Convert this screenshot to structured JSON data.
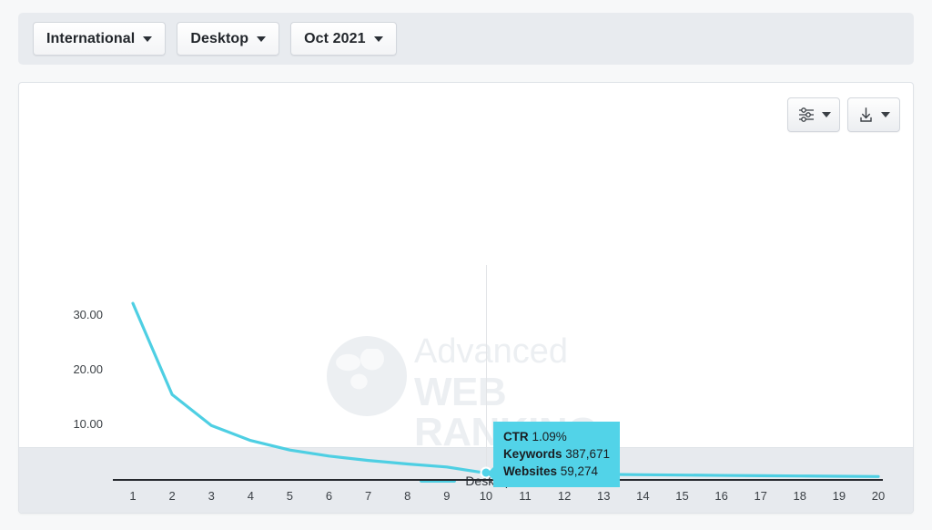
{
  "toolbar": {
    "filters": [
      {
        "label": "International",
        "icon": "chevron-down-icon"
      },
      {
        "label": "Desktop",
        "icon": "chevron-down-icon"
      },
      {
        "label": "Oct 2021",
        "icon": "chevron-down-icon"
      }
    ]
  },
  "chart_tools": [
    {
      "name": "settings-button",
      "icon": "sliders-icon"
    },
    {
      "name": "download-button",
      "icon": "download-icon"
    }
  ],
  "watermark": {
    "line1": "Advanced",
    "line2": "WEB RANKING",
    "logo": "globe-icon"
  },
  "tooltip": {
    "rows": [
      {
        "label": "CTR",
        "value": "1.09%"
      },
      {
        "label": "Keywords",
        "value": "387,671"
      },
      {
        "label": "Websites",
        "value": "59,274"
      }
    ],
    "at_position": 10
  },
  "legend": {
    "entries": [
      {
        "label": "Desktop",
        "color": "#4ecfe3"
      }
    ]
  },
  "colors": {
    "series": "#4ecfe3",
    "tooltip_bg": "#52d3e8",
    "axis": "#26292e",
    "panel": "#e8ebef",
    "legend_bg": "#e7eaee"
  },
  "chart_data": {
    "type": "line",
    "title": "",
    "xlabel": "",
    "ylabel": "",
    "grid": false,
    "legend_position": "bottom",
    "xlim": [
      1,
      20
    ],
    "ylim": [
      0,
      35
    ],
    "yticks": [
      10,
      20,
      30
    ],
    "ytick_labels": [
      "10.00",
      "20.00",
      "30.00"
    ],
    "x": [
      1,
      2,
      3,
      4,
      5,
      6,
      7,
      8,
      9,
      10,
      11,
      12,
      13,
      14,
      15,
      16,
      17,
      18,
      19,
      20
    ],
    "xtick_labels": [
      "1",
      "2",
      "3",
      "4",
      "5",
      "6",
      "7",
      "8",
      "9",
      "10",
      "11",
      "12",
      "13",
      "14",
      "15",
      "16",
      "17",
      "18",
      "19",
      "20"
    ],
    "series": [
      {
        "name": "Desktop",
        "color": "#4ecfe3",
        "values": [
          32.15,
          15.45,
          9.8,
          7.05,
          5.3,
          4.2,
          3.4,
          2.75,
          2.2,
          1.09,
          1.0,
          0.92,
          0.85,
          0.78,
          0.72,
          0.66,
          0.6,
          0.55,
          0.5,
          0.45
        ]
      }
    ],
    "annotations": [
      {
        "type": "crosshair",
        "x": 10
      },
      {
        "type": "tooltip",
        "x": 10,
        "text": "CTR 1.09% | Keywords 387,671 | Websites 59,274"
      }
    ]
  }
}
